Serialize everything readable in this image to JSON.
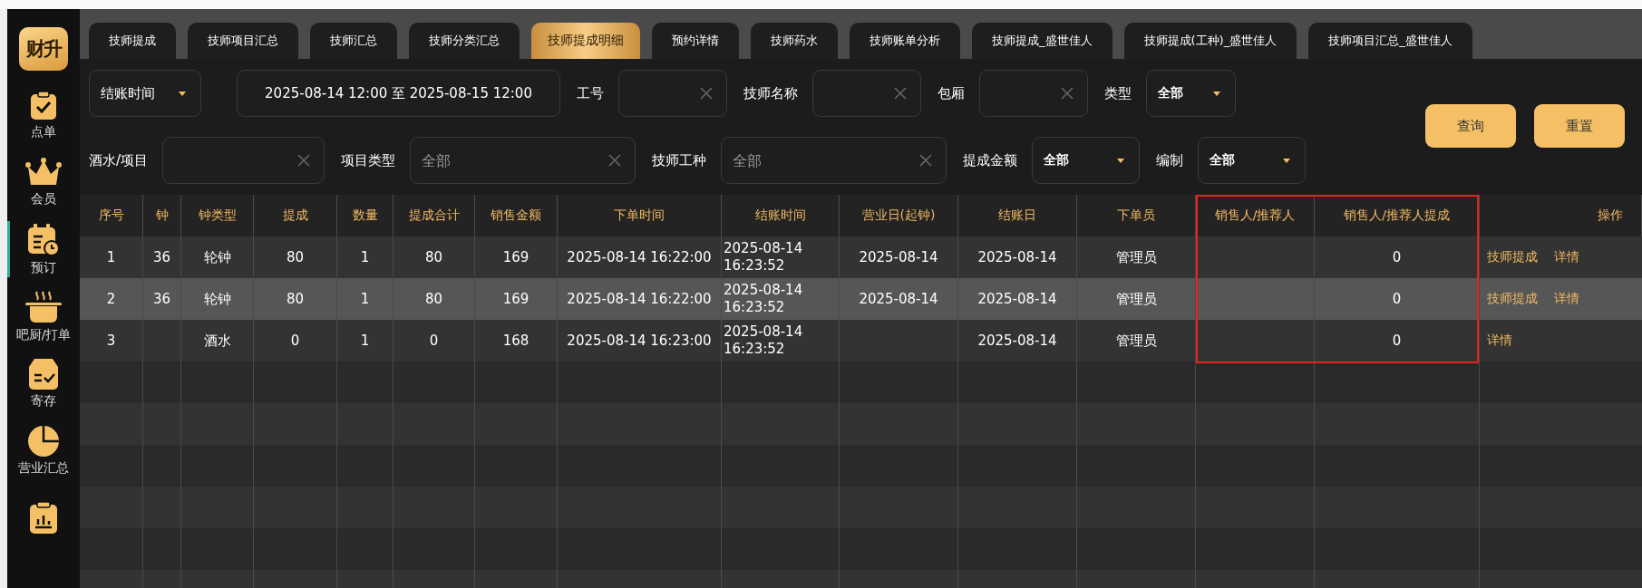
{
  "sidebar": {
    "logo": "财升",
    "items": [
      {
        "label": "点单",
        "selected": false
      },
      {
        "label": "会员",
        "selected": false
      },
      {
        "label": "预订",
        "selected": true
      },
      {
        "label": "吧厨/打单",
        "selected": false
      },
      {
        "label": "寄存",
        "selected": false
      },
      {
        "label": "营业汇总",
        "selected": false
      },
      {
        "selected": false
      }
    ]
  },
  "tabs": [
    {
      "label": "技师提成",
      "selected": false
    },
    {
      "label": "技师项目汇总",
      "selected": false
    },
    {
      "label": "技师汇总",
      "selected": false
    },
    {
      "label": "技师分类汇总",
      "selected": false
    },
    {
      "label": "技师提成明细",
      "selected": true
    },
    {
      "label": "预约详情",
      "selected": false
    },
    {
      "label": "技师药水",
      "selected": false
    },
    {
      "label": "技师账单分析",
      "selected": false
    },
    {
      "label": "技师提成_盛世佳人",
      "selected": false
    },
    {
      "label": "技师提成(工种)_盛世佳人",
      "selected": false
    },
    {
      "label": "技师项目汇总_盛世佳人",
      "selected": false
    }
  ],
  "filters": [
    [
      {
        "kind": "select",
        "value": "结账时间"
      },
      {
        "kind": "range",
        "value": "2025-08-14 12:00 至 2025-08-15 12:00"
      },
      {
        "kind": "field",
        "label": "工号"
      },
      {
        "kind": "field",
        "label": "技师名称"
      },
      {
        "kind": "field",
        "label": "包厢"
      },
      {
        "kind": "select",
        "label": "类型",
        "value": "全部"
      }
    ],
    [
      {
        "kind": "field",
        "label": "酒水/项目"
      },
      {
        "kind": "field",
        "label": "项目类型",
        "placeholder": "全部"
      },
      {
        "kind": "field",
        "label": "技师工种",
        "placeholder": "全部"
      },
      {
        "kind": "select",
        "label": "提成金额",
        "value": "全部"
      },
      {
        "kind": "select",
        "label": "编制",
        "value": "全部"
      }
    ]
  ],
  "buttons": [
    "查询",
    "重置"
  ],
  "table": {
    "columns": [
      {
        "label": "序号",
        "highlighted": false
      },
      {
        "label": "钟",
        "highlighted": false
      },
      {
        "label": "钟类型",
        "highlighted": false
      },
      {
        "label": "提成",
        "highlighted": false
      },
      {
        "label": "数量",
        "highlighted": false
      },
      {
        "label": "提成合计",
        "highlighted": false
      },
      {
        "label": "销售金额",
        "highlighted": false
      },
      {
        "label": "下单时间",
        "highlighted": false
      },
      {
        "label": "结账时间",
        "highlighted": false
      },
      {
        "label": "营业日(起钟)",
        "highlighted": false
      },
      {
        "label": "结账日",
        "highlighted": false
      },
      {
        "label": "下单员",
        "highlighted": false
      },
      {
        "label": "销售人/推荐人",
        "highlighted": true
      },
      {
        "label": "销售人/推荐人提成",
        "highlighted": true
      },
      {
        "label": "操作",
        "highlighted": false
      }
    ],
    "rows": [
      {
        "selected": false,
        "cells": [
          "1",
          "36",
          "轮钟",
          "80",
          "1",
          "80",
          "169",
          "2025-08-14 16:22:00",
          "2025-08-14 16:23:52",
          "2025-08-14",
          "2025-08-14",
          "管理员",
          null,
          "0"
        ],
        "actions": [
          "技师提成",
          "详情"
        ]
      },
      {
        "selected": true,
        "cells": [
          "2",
          "36",
          "轮钟",
          "80",
          "1",
          "80",
          "169",
          "2025-08-14 16:22:00",
          "2025-08-14 16:23:52",
          "2025-08-14",
          "2025-08-14",
          "管理员",
          null,
          "0"
        ],
        "actions": [
          "技师提成",
          "详情"
        ]
      },
      {
        "selected": false,
        "cells": [
          "3",
          null,
          "酒水",
          "0",
          "1",
          "0",
          "168",
          "2025-08-14 16:23:00",
          "2025-08-14 16:23:52",
          null,
          "2025-08-14",
          "管理员",
          null,
          "0"
        ],
        "actions": [
          "详情"
        ]
      }
    ]
  }
}
